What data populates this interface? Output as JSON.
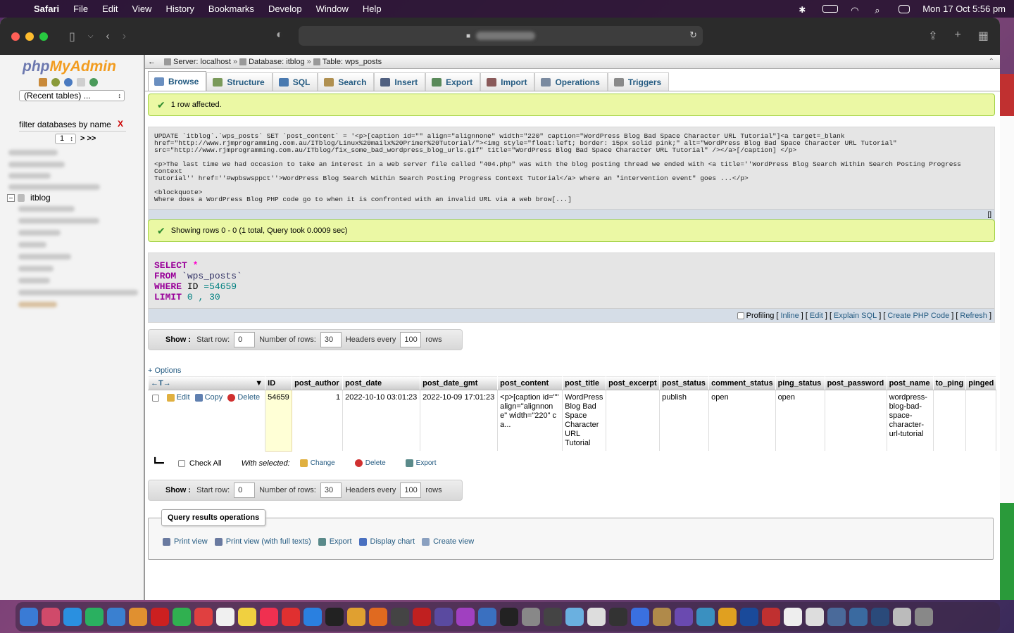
{
  "menubar": {
    "app": "Safari",
    "items": [
      "File",
      "Edit",
      "View",
      "History",
      "Bookmarks",
      "Develop",
      "Window",
      "Help"
    ],
    "clock": "Mon 17 Oct  5:56 pm"
  },
  "browser": {
    "url_blurred": true
  },
  "nav": {
    "logo_php": "php",
    "logo_my": "MyAdmin",
    "recent_tables": "(Recent tables) ...",
    "filter_placeholder": "filter databases by name",
    "filter_clear": "X",
    "page": "1",
    "page_next": "> >>",
    "db_name": "itblog"
  },
  "breadcrumb": {
    "server": "Server: localhost",
    "database": "Database: itblog",
    "table": "Table: wps_posts",
    "sep": "»"
  },
  "tabs": [
    {
      "label": "Browse",
      "icon": "browse-icon",
      "color": "#6a8fc0"
    },
    {
      "label": "Structure",
      "icon": "structure-icon",
      "color": "#7a9a5a"
    },
    {
      "label": "SQL",
      "icon": "sql-icon",
      "color": "#4a7ab0"
    },
    {
      "label": "Search",
      "icon": "search-icon",
      "color": "#b09050"
    },
    {
      "label": "Insert",
      "icon": "insert-icon",
      "color": "#506080"
    },
    {
      "label": "Export",
      "icon": "export-icon",
      "color": "#5a8a5a"
    },
    {
      "label": "Import",
      "icon": "import-icon",
      "color": "#8a5a5a"
    },
    {
      "label": "Operations",
      "icon": "wrench-icon",
      "color": "#7a8aa0"
    },
    {
      "label": "Triggers",
      "icon": "triggers-icon",
      "color": "#8a8a8a"
    }
  ],
  "messages": {
    "affected": "1 row affected.",
    "showing": "Showing rows 0 - 0 (1 total, Query took 0.0009 sec)"
  },
  "update_sql": "UPDATE `itblog`.`wps_posts` SET `post_content` = '<p>[caption id=\"\" align=\"alignnone\" width=\"220\" caption=\"WordPress Blog Bad Space Character URL Tutorial\"]<a target=_blank\nhref=\"http://www.rjmprogramming.com.au/ITblog/Linux%20mailx%20Primer%20Tutorial/\"><img style=\"float:left; border: 15px solid pink;\" alt=\"WordPress Blog Bad Space Character URL Tutorial\"\nsrc=\"http://www.rjmprogramming.com.au/ITblog/fix_some_bad_wordpress_blog_urls.gif\" title=\"WordPress Blog Bad Space Character URL Tutorial\" /></a>[/caption] </p>\n\n<p>The last time we had occasion to take an interest in a web server file called \"404.php\" was with the blog posting thread we ended with <a title=''WordPress Blog Search Within Search Posting Progress Context\nTutorial'' href=''#wpbswsppct''>WordPress Blog Search Within Search Posting Progress Context Tutorial</a> where an \"intervention event\" goes ...</p>\n\n<blockquote>\nWhere does a WordPress Blog PHP code go to when it is confronted with an invalid URL via a web brow[...]",
  "update_bracket": "[]",
  "select_sql": {
    "select": "SELECT",
    "star": "*",
    "from": "FROM",
    "table": "`wps_posts`",
    "where": "WHERE",
    "where_col": "ID",
    "where_op": "=",
    "where_val": "54659",
    "limit": "LIMIT",
    "limit_a": "0",
    "limit_sep": ",",
    "limit_b": "30"
  },
  "profiling": {
    "label": "Profiling",
    "links": [
      "Inline",
      "Edit",
      "Explain SQL",
      "Create PHP Code",
      "Refresh"
    ]
  },
  "showbar": {
    "show": "Show :",
    "start_row_label": "Start row:",
    "start_row": "0",
    "num_rows_label": "Number of rows:",
    "num_rows": "30",
    "headers_label": "Headers every",
    "headers": "100",
    "rows": "rows"
  },
  "options_link": "+ Options",
  "table": {
    "columns": [
      "ID",
      "post_author",
      "post_date",
      "post_date_gmt",
      "post_content",
      "post_title",
      "post_excerpt",
      "post_status",
      "comment_status",
      "ping_status",
      "post_password",
      "post_name",
      "to_ping",
      "pinged"
    ],
    "row": {
      "actions": [
        "Edit",
        "Copy",
        "Delete"
      ],
      "ID": "54659",
      "post_author": "1",
      "post_date": "2022-10-10 03:01:23",
      "post_date_gmt": "2022-10-09 17:01:23",
      "post_content": "<p>[caption id=\"\" align=\"alignnone\" width=\"220\" ca...",
      "post_title": "WordPress Blog Bad Space Character URL Tutorial",
      "post_excerpt": "",
      "post_status": "publish",
      "comment_status": "open",
      "ping_status": "open",
      "post_password": "",
      "post_name": "wordpress-blog-bad-space-character-url-tutorial",
      "to_ping": "",
      "pinged": ""
    }
  },
  "withsel": {
    "check_all": "Check All",
    "with_selected": "With selected:",
    "change": "Change",
    "delete": "Delete",
    "export": "Export"
  },
  "qro": {
    "title": "Query results operations",
    "links": [
      "Print view",
      "Print view (with full texts)",
      "Export",
      "Display chart",
      "Create view"
    ]
  },
  "colors": {
    "link": "#235a81",
    "success_bg": "#ebf8a4",
    "keyword": "#990099"
  }
}
